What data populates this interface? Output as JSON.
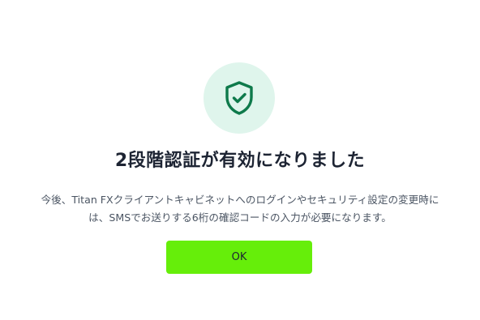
{
  "dialog": {
    "icon": "shield-check-icon",
    "title": "2段階認証が有効になりました",
    "message_line1": "今後、Titan FXクライアントキャビネットへのログインやセキュリティ設定の変更時に",
    "message_line2": "は、SMSでお送りする6桁の確認コードの入力が必要になります。",
    "ok_label": "OK"
  },
  "colors": {
    "icon_bg": "#dff5ec",
    "icon_fg": "#0e7a4b",
    "button_bg": "#66ee0a",
    "title_text": "#1d2433",
    "body_text": "#4b5563"
  }
}
